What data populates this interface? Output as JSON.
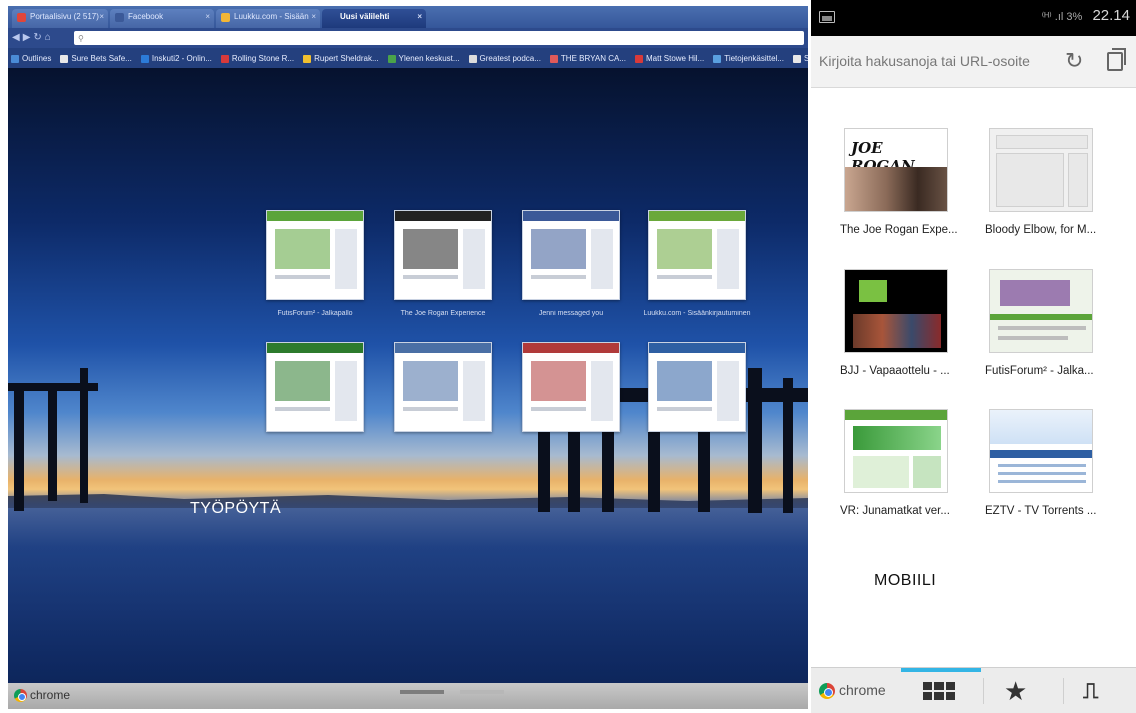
{
  "desktop": {
    "tabs": [
      {
        "label": "Portaalisivu (2 517) ",
        "color": "#e0463a"
      },
      {
        "label": "Facebook",
        "color": "#3b5998"
      },
      {
        "label": "Luukku.com - Sisään",
        "color": "#f2b636"
      },
      {
        "label": "Uusi välilehti",
        "color": "#ffffff"
      }
    ],
    "url": "",
    "bookmarks": [
      {
        "label": "Outlines",
        "color": "#4a8bd6"
      },
      {
        "label": "Sure Bets Safe...",
        "color": "#e8e8e8"
      },
      {
        "label": "Inskuti2 - Onlin...",
        "color": "#2c7bd8"
      },
      {
        "label": "Rolling Stone R...",
        "color": "#d83a3a"
      },
      {
        "label": "Rupert Sheldrak...",
        "color": "#f0c030"
      },
      {
        "label": "Ylenen keskust...",
        "color": "#4aa34a"
      },
      {
        "label": "Greatest podca...",
        "color": "#dcdcdc"
      },
      {
        "label": "THE BRYAN CA...",
        "color": "#e05a5a"
      },
      {
        "label": "Matt Stowe Hil...",
        "color": "#d83a3a"
      },
      {
        "label": "Tietojenkäsittel...",
        "color": "#5aa0e0"
      },
      {
        "label": "Shopp...",
        "color": "#e8e8e8"
      }
    ],
    "thumbnails": [
      {
        "label": "FutisForum² - Jalkapallo",
        "accent": "#5ba43a"
      },
      {
        "label": "The Joe Rogan Experience",
        "accent": "#222222"
      },
      {
        "label": "Jenni messaged you",
        "accent": "#3b5998"
      },
      {
        "label": "Luukku.com - Sisäänkirjautuminen",
        "accent": "#6aa83a"
      },
      {
        "label": "",
        "accent": "#2d7b2d"
      },
      {
        "label": "",
        "accent": "#4a6fa5"
      },
      {
        "label": "",
        "accent": "#b03a3a"
      },
      {
        "label": "",
        "accent": "#2e5fa3"
      }
    ],
    "area_label": "TYÖPÖYTÄ",
    "dock_brand": "chrome"
  },
  "mobile": {
    "status": {
      "signal": "⁽ᴴ⁾ .ıl 3%",
      "time": "22.14"
    },
    "url_placeholder": "Kirjoita hakusanoja tai URL-osoite",
    "tiles": [
      {
        "label": "The Joe Rogan Expe...",
        "kind": "rogan",
        "thumb_text": "JOE ROGAN"
      },
      {
        "label": "Bloody Elbow, for M...",
        "kind": "blank"
      },
      {
        "label": "BJJ - Vapaaottelu - ...",
        "kind": "kk"
      },
      {
        "label": "FutisForum² - Jalka...",
        "kind": "futis"
      },
      {
        "label": "VR: Junamatkat ver...",
        "kind": "vr"
      },
      {
        "label": "EZTV - TV Torrents ...",
        "kind": "eztv"
      }
    ],
    "area_label": "MOBIILI",
    "bottom": {
      "brand": "chrome",
      "icons": [
        "grid-icon",
        "star-icon",
        "other-devices-icon"
      ]
    }
  }
}
